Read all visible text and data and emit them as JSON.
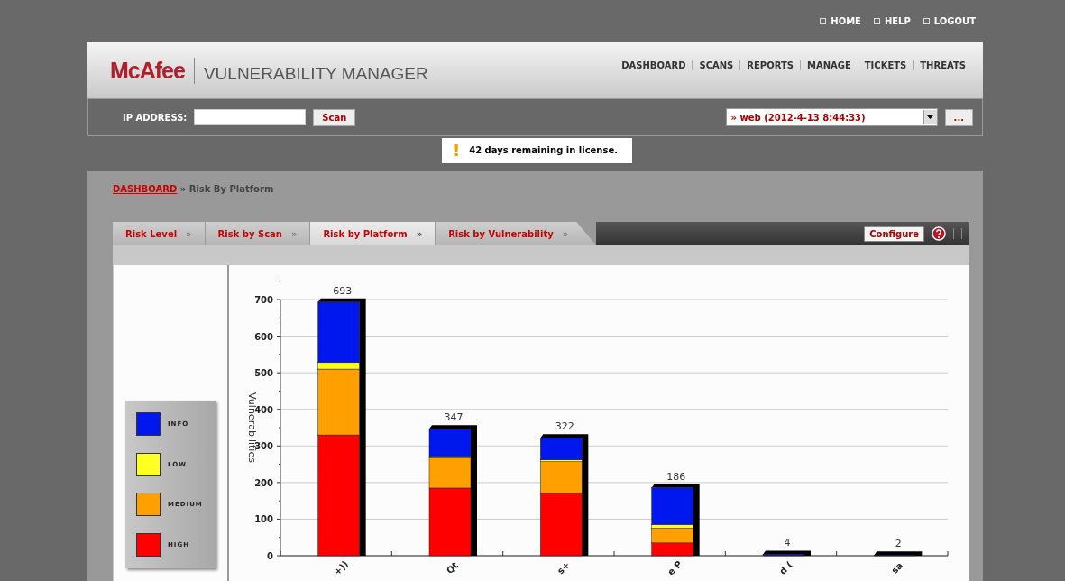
{
  "top_links": [
    "HOME",
    "HELP",
    "LOGOUT"
  ],
  "header": {
    "logo": "McAfee",
    "product": "VULNERABILITY MANAGER"
  },
  "nav": [
    "DASHBOARD",
    "SCANS",
    "REPORTS",
    "MANAGE",
    "TICKETS",
    "THREATS"
  ],
  "toolbar": {
    "ip_label": "IP ADDRESS:",
    "scan_button": "Scan",
    "scan_select": "» web (2012-4-13 8:44:33)",
    "more_button": "..."
  },
  "notice": {
    "icon": "!",
    "text": "42 days remaining in license."
  },
  "breadcrumb": {
    "link": "DASHBOARD",
    "current": "» Risk By Platform"
  },
  "tabs": [
    {
      "label": "Risk Level",
      "arrow": "»",
      "selected": false
    },
    {
      "label": "Risk by Scan",
      "arrow": "»",
      "selected": false
    },
    {
      "label": "Risk by Platform",
      "arrow": "»",
      "selected": true
    },
    {
      "label": "Risk by Vulnerability",
      "arrow": "»",
      "selected": false
    }
  ],
  "configure_button": "Configure",
  "chart_data": {
    "type": "bar",
    "stacked": true,
    "grid": true,
    "ylabel": "Vulnerabilities",
    "categories": [
      "+))",
      "Qt",
      "s+",
      "e P",
      "d (",
      "sa"
    ],
    "ylim": [
      0,
      700
    ],
    "yticks": [
      0,
      100,
      200,
      300,
      400,
      500,
      600,
      700
    ],
    "series": [
      {
        "name": "HIGH",
        "color": "#ff0000",
        "values": [
          330,
          185,
          172,
          35,
          0,
          0
        ]
      },
      {
        "name": "MEDIUM",
        "color": "#ffa000",
        "values": [
          180,
          83,
          85,
          40,
          0,
          0
        ]
      },
      {
        "name": "LOW",
        "color": "#ffff20",
        "values": [
          18,
          4,
          5,
          10,
          0,
          0
        ]
      },
      {
        "name": "INFO",
        "color": "#0018ee",
        "values": [
          165,
          75,
          60,
          101,
          4,
          2
        ]
      }
    ],
    "value_labels": [
      "693",
      "347",
      "322",
      "186",
      "4",
      "2"
    ]
  }
}
